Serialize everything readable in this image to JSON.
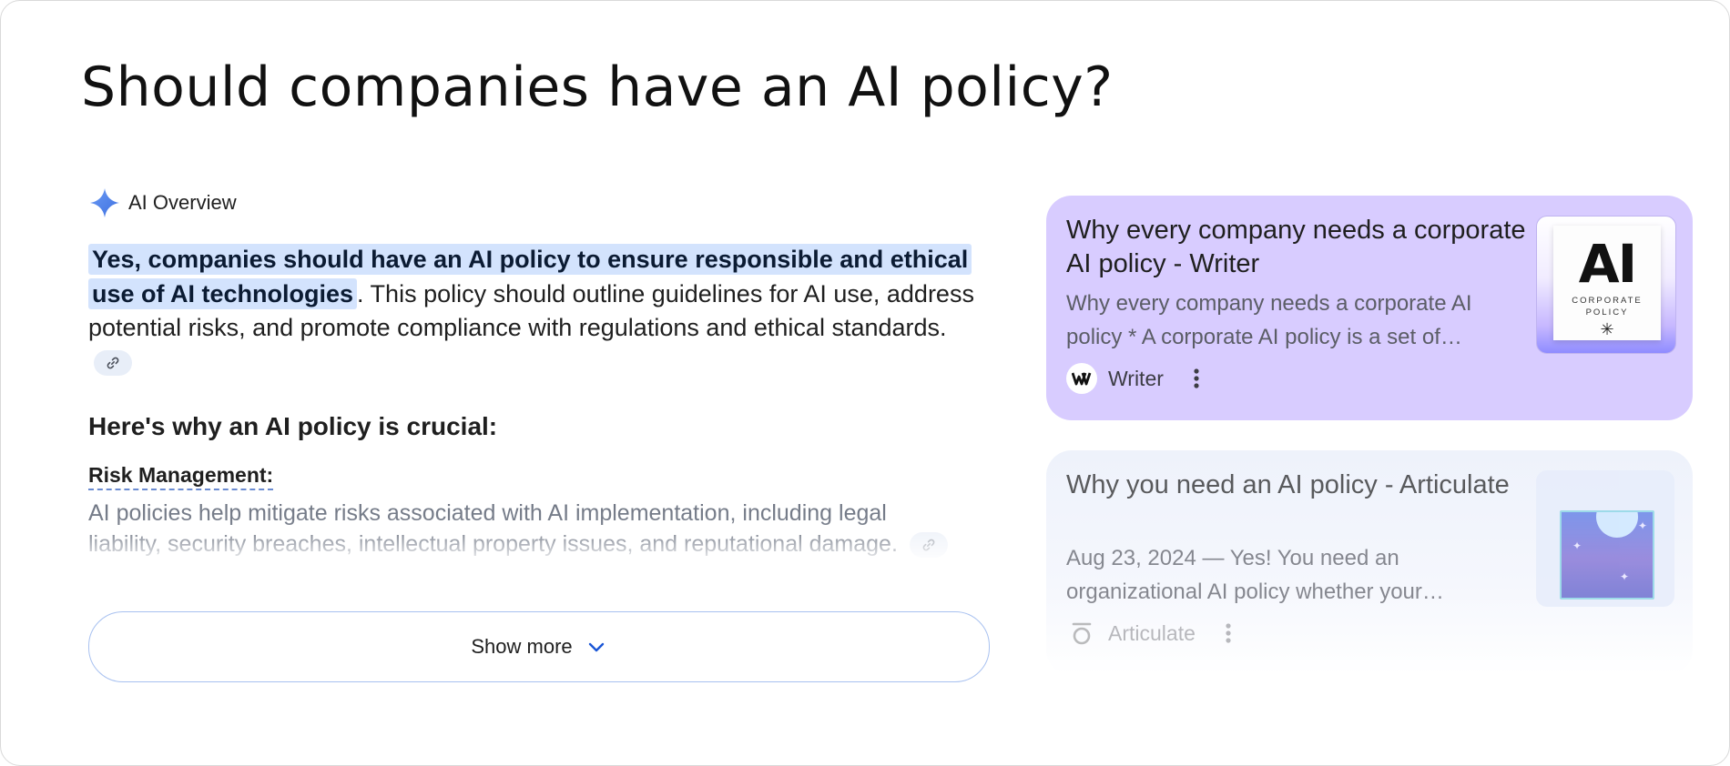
{
  "page": {
    "title": "Should companies have an AI policy?"
  },
  "overview": {
    "header_label": "AI Overview",
    "answer_highlight": "Yes, companies should have an AI policy to ensure responsible and ethical use of AI technologies",
    "answer_rest": ". This policy should outline guidelines for AI use, address potential risks, and promote compliance with regulations and ethical standards.",
    "why_heading": "Here's why an AI policy is crucial:",
    "risk_title": "Risk Management:",
    "risk_text": "AI policies help mitigate risks associated with AI implementation, including legal liability, security breaches, intellectual property issues, and reputational damage.",
    "show_more_label": "Show more"
  },
  "sources": [
    {
      "title": "Why every company needs a corporate AI policy - Writer",
      "snippet": "Why every company needs a corporate AI policy * A corporate AI policy is a set of…",
      "source_name": "Writer",
      "thumbnail": {
        "big_text": "AI",
        "sub_text_1": "CORPORATE",
        "sub_text_2": "POLICY"
      },
      "background": "#d8ccff"
    },
    {
      "title": "Why you need an AI policy - Articulate",
      "snippet": "Aug 23, 2024 — Yes! You need an organizational AI policy whether your…",
      "source_name": "Articulate",
      "background": "#eef2fb"
    }
  ],
  "colors": {
    "highlight": "#d3e3fd",
    "accent_blue": "#1a56d6",
    "spark_blue": "#4a7fe8",
    "card_purple": "#d8ccff"
  }
}
